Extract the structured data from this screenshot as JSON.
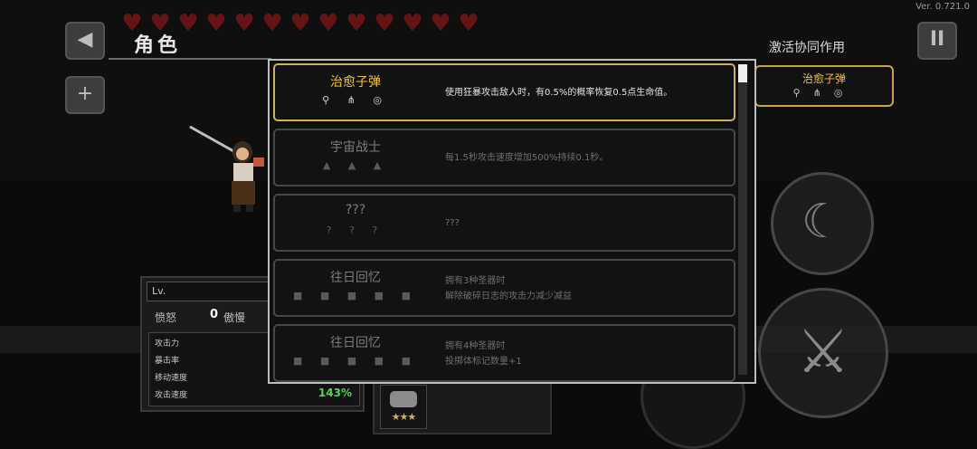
{
  "version": "Ver. 0.721.0",
  "hud": {
    "heart_count": 13,
    "heart_icon": "heart-icon"
  },
  "left_buttons": [
    {
      "name": "menu-icon",
      "glyph": "◀"
    },
    {
      "name": "plus-icon",
      "glyph": "+"
    }
  ],
  "pause_glyph": "II",
  "panel_title": "角色",
  "synergy": {
    "title": "激活协同作用",
    "active": {
      "name": "治愈子弹",
      "icons": [
        "boot-icon",
        "crossbow-icon",
        "rope-icon"
      ]
    }
  },
  "stats_panel": {
    "lv_label": "Lv.",
    "rage_label": "愤怒",
    "rage_value": "0",
    "arrogance_label": "傲慢",
    "rows": [
      {
        "label": "攻击力",
        "value": ""
      },
      {
        "label": "暴击率",
        "value": ""
      },
      {
        "label": "移动速度",
        "value": ""
      },
      {
        "label": "攻击速度",
        "value": "143%"
      }
    ]
  },
  "relic": {
    "icon": "barrel-icon",
    "stars": "★★★"
  },
  "popup": {
    "items": [
      {
        "name": "治愈子弹",
        "icons": "⚲ ⋔ ◎",
        "desc": [
          "使用狂暴攻击敌人时，有0.5%的概率恢复0.5点生命值。"
        ],
        "active": true
      },
      {
        "name": "宇宙战士",
        "icons": "▲ ▲ ▲",
        "desc": [
          "每1.5秒攻击速度增加500%持续0.1秒。"
        ],
        "active": false
      },
      {
        "name": "???",
        "icons": "? ? ?",
        "desc": [
          "???"
        ],
        "active": false
      },
      {
        "name": "往日回忆",
        "icons": "■ ■ ■ ■ ■",
        "desc": [
          "拥有3种圣器时",
          "解除破碎日志的攻击力减少减益"
        ],
        "active": false
      },
      {
        "name": "往日回忆",
        "icons": "■ ■ ■ ■ ■",
        "desc": [
          "拥有4种圣器时",
          "投掷体标记数量+1"
        ],
        "active": false
      }
    ]
  },
  "right_buttons": [
    {
      "name": "crescent-skill-icon",
      "glyph": "☾"
    },
    {
      "name": "sword-attack-icon",
      "glyph": "⚔"
    }
  ],
  "colors": {
    "accent": "#f2c230",
    "border_active": "#d2b155",
    "stat_green": "#4fd84a"
  }
}
